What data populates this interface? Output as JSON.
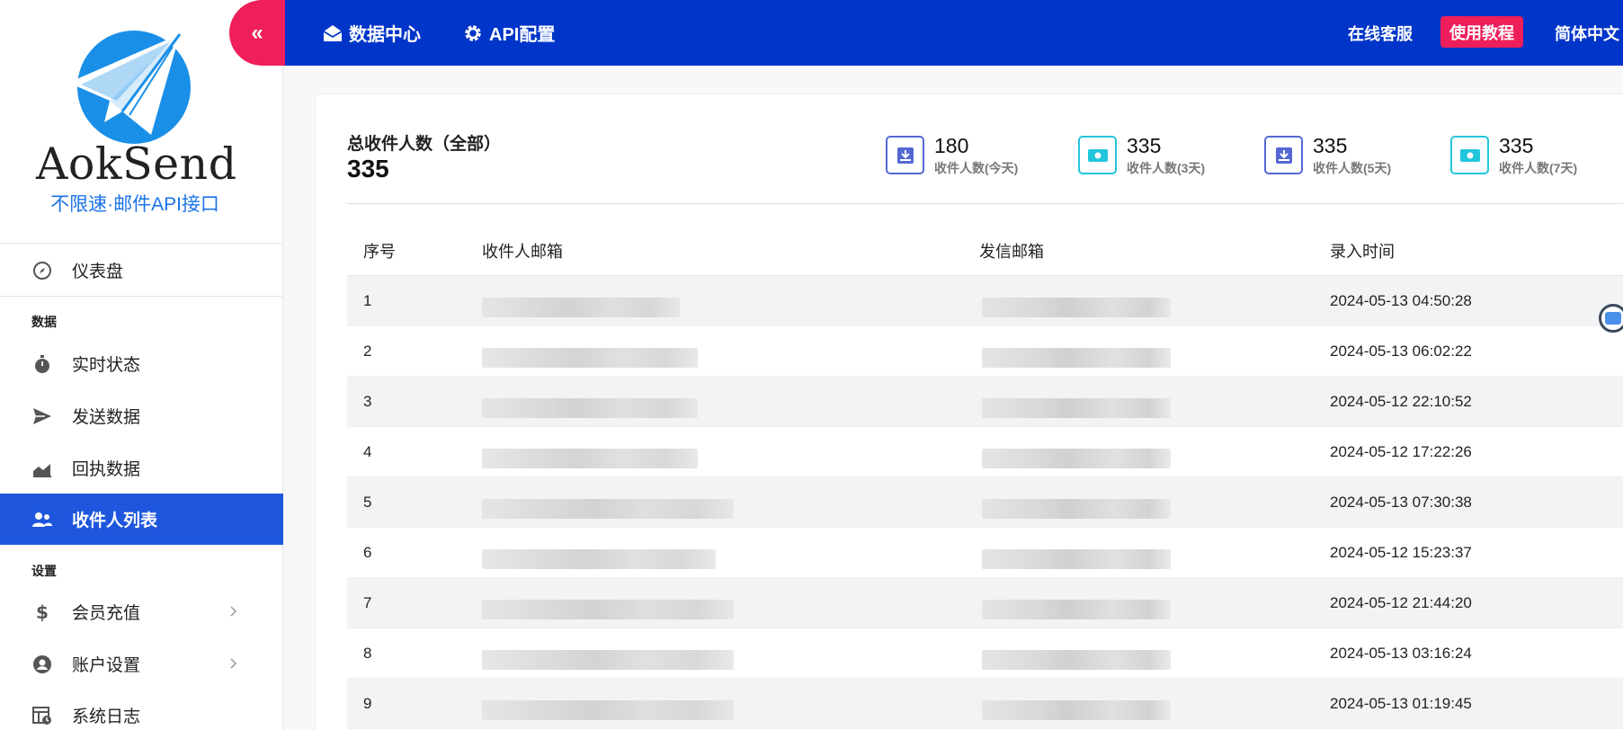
{
  "brand": {
    "name": "AokSend",
    "tagline": "不限速·邮件API接口",
    "primary_color": "#0035c9",
    "accent_color": "#ee1f5a",
    "active_color": "#1e56dd"
  },
  "sidebar": {
    "collapse_icon": "«",
    "items": [
      {
        "label": "仪表盘",
        "icon": "compass-icon"
      },
      {
        "label": "实时状态",
        "icon": "stopwatch-icon"
      },
      {
        "label": "发送数据",
        "icon": "paper-plane-icon"
      },
      {
        "label": "回执数据",
        "icon": "area-chart-icon"
      },
      {
        "label": "收件人列表",
        "icon": "users-icon",
        "active": true
      },
      {
        "label": "会员充值",
        "icon": "dollar-icon",
        "has_submenu": true
      },
      {
        "label": "账户设置",
        "icon": "user-circle-icon",
        "has_submenu": true
      },
      {
        "label": "系统日志",
        "icon": "log-table-icon"
      }
    ],
    "section_data": "数据",
    "section_settings": "设置"
  },
  "topbar": {
    "tabs": [
      {
        "label": "数据中心",
        "icon": "envelope-open-icon"
      },
      {
        "label": "API配置",
        "icon": "gear-icon"
      }
    ],
    "customer_service": "在线客服",
    "tutorial": "使用教程",
    "language": "简体中文"
  },
  "summary": {
    "total_label": "总收件人数（全部）",
    "total_value": "335",
    "stats": [
      {
        "value": "180",
        "label": "收件人数(今天)",
        "icon": "inbox-download-icon"
      },
      {
        "value": "335",
        "label": "收件人数(3天)",
        "icon": "money-icon"
      },
      {
        "value": "335",
        "label": "收件人数(5天)",
        "icon": "inbox-download-icon"
      },
      {
        "value": "335",
        "label": "收件人数(7天)",
        "icon": "money-icon"
      }
    ]
  },
  "table": {
    "headers": [
      "序号",
      "收件人邮箱",
      "发信邮箱",
      "录入时间"
    ],
    "rows": [
      {
        "idx": "1",
        "time": "2024-05-13 04:50:28"
      },
      {
        "idx": "2",
        "time": "2024-05-13 06:02:22"
      },
      {
        "idx": "3",
        "time": "2024-05-12 22:10:52"
      },
      {
        "idx": "4",
        "time": "2024-05-12 17:22:26"
      },
      {
        "idx": "5",
        "time": "2024-05-13 07:30:38"
      },
      {
        "idx": "6",
        "time": "2024-05-12 15:23:37"
      },
      {
        "idx": "7",
        "time": "2024-05-12 21:44:20"
      },
      {
        "idx": "8",
        "time": "2024-05-13 03:16:24"
      },
      {
        "idx": "9",
        "time": "2024-05-13 01:19:45"
      }
    ]
  }
}
